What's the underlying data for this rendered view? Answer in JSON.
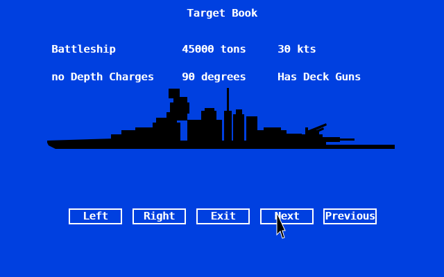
{
  "screen": {
    "title": "Target Book",
    "background_color": "#0040e0",
    "text_color": "#ffffff",
    "ship_color": "#000000"
  },
  "ship": {
    "class": "Battleship",
    "tonnage": "45000 tons",
    "speed": "30 kts",
    "depth_charges": "no Depth Charges",
    "turn": "90 degrees",
    "guns": "Has Deck Guns"
  },
  "buttons": {
    "left": "Left",
    "right": "Right",
    "exit": "Exit",
    "next": "Next",
    "previous": "Previous"
  },
  "cursor": {
    "icon": "arrow-pointer-icon"
  }
}
